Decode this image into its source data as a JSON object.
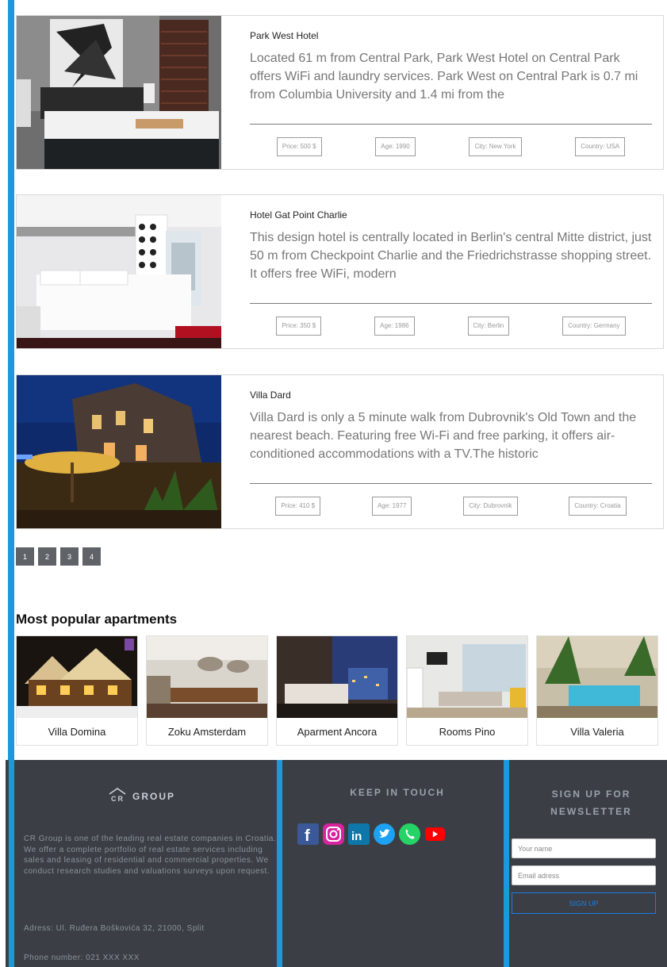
{
  "hotels": [
    {
      "title": "Park West Hotel",
      "description": "Located 61 m from Central Park, Park West Hotel on Central Park offers WiFi and laundry services. Park West on Central Park is 0.7 mi from Columbia University and 1.4 mi from the",
      "price": "Price: 500 $",
      "age": "Age: 1990",
      "city": "City: New York",
      "country": "Country: USA"
    },
    {
      "title": "Hotel Gat Point Charlie",
      "description": "This design hotel is centrally located in Berlin's central Mitte district, just 50 m from Checkpoint Charlie and the Friedrichstrasse shopping street. It offers free WiFi, modern",
      "price": "Price: 350 $",
      "age": "Age: 1986",
      "city": "City: Berlin",
      "country": "Country: Germany"
    },
    {
      "title": "Villa Dard",
      "description": "Villa Dard is only a 5 minute walk from Dubrovnik's Old Town and the nearest beach. Featuring free Wi-Fi and free parking, it offers air-conditioned accommodations with a TV.The historic",
      "price": "Price: 410 $",
      "age": "Age: 1977",
      "city": "City: Dubrovnik",
      "country": "Country: Croatia"
    }
  ],
  "pagination": [
    "1",
    "2",
    "3",
    "4"
  ],
  "popular": {
    "title": "Most popular apartments",
    "items": [
      "Villa Domina",
      "Zoku Amsterdam",
      "Aparment Ancora",
      "Rooms Pino",
      "Villa Valeria"
    ]
  },
  "footer": {
    "brand": "GROUP",
    "about": "CR Group is one of the leading real estate companies in Croatia. We offer a complete portfolio of real estate services including sales and leasing of residential and commercial properties. We conduct research studies and valuations surveys upon request.",
    "address": "Adress: Ul. Ruđera Boškovića 32, 21000, Split",
    "phone": "Phone number: 021 XXX XXX",
    "keep_in_touch": "KEEP IN TOUCH",
    "socials": [
      "facebook-icon",
      "instagram-icon",
      "linkedin-icon",
      "twitter-icon",
      "whatsapp-icon",
      "youtube-icon"
    ],
    "newsletter_title": "SIGN UP FOR NEWSLETTER",
    "name_placeholder": "Your name",
    "email_placeholder": "Email adress",
    "signup_label": "SIGN UP"
  },
  "colors": {
    "accent": "#1a9ad9",
    "footer_bg": "#3b3f45",
    "signup_blue": "#1a7ee6"
  }
}
